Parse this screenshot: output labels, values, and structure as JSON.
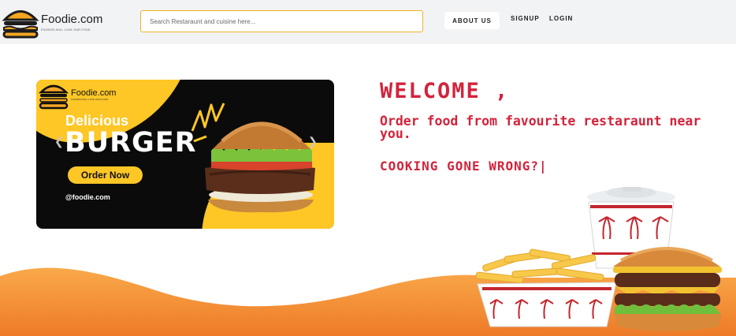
{
  "navbar": {
    "brand": "Foodie.com",
    "tagline": "FOODIES WILL LOVE OUR FOOD",
    "search_placeholder": "Search Restaraunt and cuisine here...",
    "links": {
      "about": "ABOUT US",
      "signup": "SIGNUP",
      "login": "LOGIN"
    }
  },
  "banner": {
    "brand": "Foodie.com",
    "tagline": "FOODIES WILL LOVE OUR FOOD",
    "headline_small": "Delicious",
    "headline_big": "BURGER",
    "cta": "Order Now",
    "handle": "@foodie.com",
    "prev_icon": "chevron-left-icon",
    "next_icon": "chevron-right-icon"
  },
  "hero": {
    "welcome": "WELCOME ,",
    "subtitle": "Order food from favourite restaraunt near you.",
    "typing": "COOKING GONE WRONG?|"
  },
  "colors": {
    "accent": "#d3233c",
    "brand_yellow": "#fec726",
    "wave_orange": "#f08a2a",
    "navbar_bg": "#f1f3f4"
  }
}
